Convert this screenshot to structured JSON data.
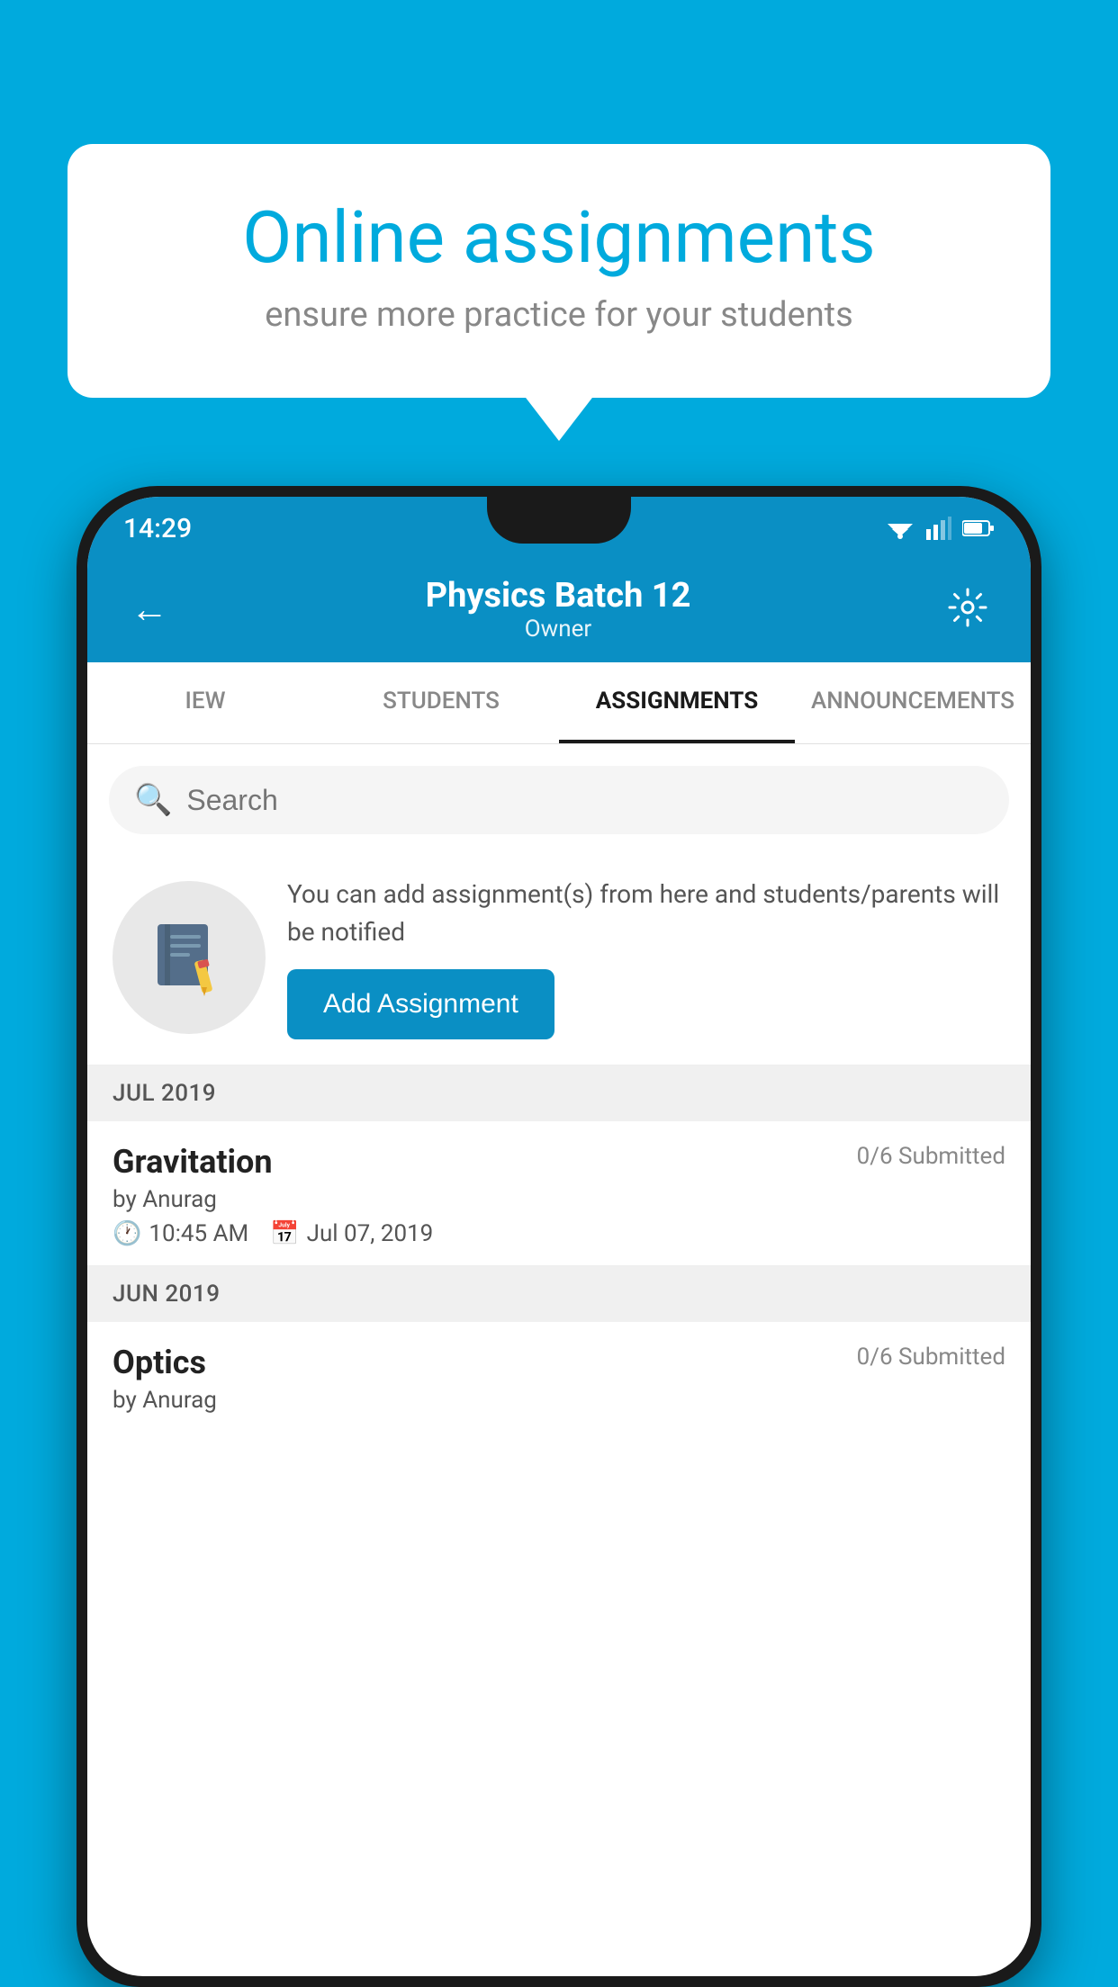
{
  "background_color": "#00AADD",
  "bubble": {
    "title": "Online assignments",
    "subtitle": "ensure more practice for your students"
  },
  "status_bar": {
    "time": "14:29"
  },
  "header": {
    "title": "Physics Batch 12",
    "subtitle": "Owner",
    "back_label": "←",
    "settings_label": "⚙"
  },
  "tabs": [
    {
      "label": "IEW",
      "active": false
    },
    {
      "label": "STUDENTS",
      "active": false
    },
    {
      "label": "ASSIGNMENTS",
      "active": true
    },
    {
      "label": "ANNOUNCEMENTS",
      "active": false
    }
  ],
  "search": {
    "placeholder": "Search"
  },
  "promo": {
    "text": "You can add assignment(s) from here and students/parents will be notified",
    "button_label": "Add Assignment"
  },
  "sections": [
    {
      "label": "JUL 2019",
      "assignments": [
        {
          "title": "Gravitation",
          "submitted": "0/6 Submitted",
          "by": "by Anurag",
          "time": "10:45 AM",
          "date": "Jul 07, 2019"
        }
      ]
    },
    {
      "label": "JUN 2019",
      "assignments": [
        {
          "title": "Optics",
          "submitted": "0/6 Submitted",
          "by": "by Anurag",
          "time": "",
          "date": ""
        }
      ]
    }
  ]
}
